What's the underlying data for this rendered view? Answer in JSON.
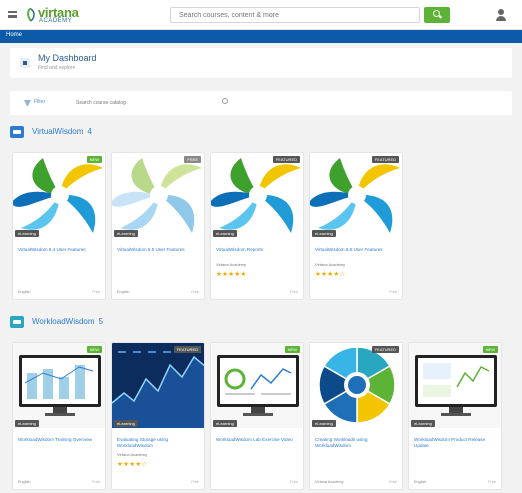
{
  "topbar": {
    "logo_text": "virtana",
    "logo_sub": "ACADEMY",
    "search_placeholder": "Search courses, content & more",
    "colors": {
      "accent": "#5db336",
      "brand": "#0a5aa8"
    }
  },
  "nav": {
    "home": "Home"
  },
  "dashboard": {
    "title": "My Dashboard",
    "subtitle": "Find and explore"
  },
  "filter": {
    "label": "Filter",
    "search_placeholder": "Search course catalog"
  },
  "sections": [
    {
      "title": "VirtualWisdom",
      "count": "4",
      "icon": "course-icon",
      "color": "#2d7bd0",
      "cards": [
        {
          "badge": "NEW",
          "badge_color": "#5db336",
          "tag": "eLearning",
          "title": "VirtualWisdom 6.4 User Features",
          "meta": "",
          "stars": "",
          "foot": "English",
          "foot_r": "Free",
          "thumb": "swirl",
          "variant": "bright"
        },
        {
          "badge": "FREE",
          "badge_color": "#888888",
          "tag": "eLearning",
          "title": "VirtualWisdom 6.5 User Features",
          "meta": "",
          "stars": "",
          "foot": "English",
          "foot_r": "Free",
          "thumb": "swirl",
          "variant": "faded"
        },
        {
          "badge": "FEATURED",
          "badge_color": "#555555",
          "tag": "eLearning",
          "title": "VirtualWisdom Reports",
          "meta": "Virtana Academy",
          "stars": "★★★★★",
          "foot": "",
          "foot_r": "Free",
          "thumb": "swirl",
          "variant": "bright"
        },
        {
          "badge": "FEATURED",
          "badge_color": "#555555",
          "tag": "eLearning",
          "title": "VirtualWisdom 6.6 User Features",
          "meta": "Virtana Academy",
          "stars": "★★★★☆",
          "foot": "",
          "foot_r": "Free",
          "thumb": "swirl",
          "variant": "bright"
        }
      ]
    },
    {
      "title": "WorkloadWisdom",
      "count": "5",
      "icon": "course-icon",
      "color": "#2aa7c0",
      "cards": [
        {
          "badge": "NEW",
          "badge_color": "#5db336",
          "tag": "eLearning",
          "title": "WorkloadWisdom Training Overview",
          "meta": "",
          "stars": "",
          "foot": "English",
          "foot_r": "Free",
          "thumb": "monitor-bars",
          "variant": ""
        },
        {
          "badge": "FEATURED",
          "badge_color": "#555555",
          "tag": "eLearning",
          "title": "Evaluating Storage using WorkloadWisdom",
          "meta": "Virtana Academy",
          "stars": "★★★★☆",
          "foot": "",
          "foot_r": "Free",
          "thumb": "stock",
          "variant": ""
        },
        {
          "badge": "NEW",
          "badge_color": "#5db336",
          "tag": "eLearning",
          "title": "WorkloadWisdom Lab Exercise Video",
          "meta": "",
          "stars": "",
          "foot": "",
          "foot_r": "Free",
          "thumb": "monitor-lines",
          "variant": ""
        },
        {
          "badge": "FEATURED",
          "badge_color": "#555555",
          "tag": "eLearning",
          "title": "Creating Workloads using WorkloadWisdom",
          "meta": "",
          "stars": "",
          "foot": "Virtana Academy",
          "foot_r": "Free",
          "thumb": "pie",
          "variant": ""
        },
        {
          "badge": "NEW",
          "badge_color": "#5db336",
          "tag": "eLearning",
          "title": "WorkloadWisdom Product Release Update",
          "meta": "",
          "stars": "",
          "foot": "English",
          "foot_r": "Free",
          "thumb": "monitor-chart",
          "variant": ""
        }
      ]
    }
  ]
}
